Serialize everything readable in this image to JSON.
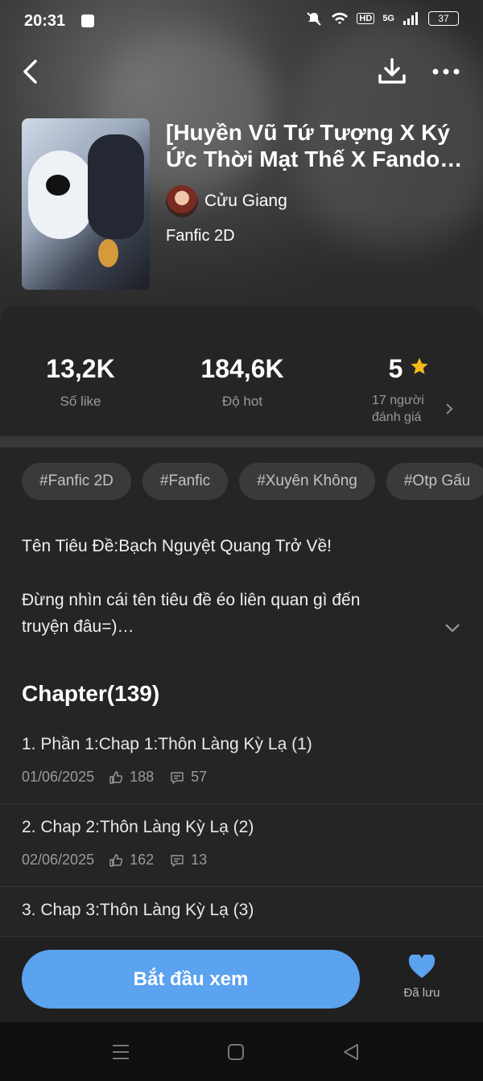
{
  "status_bar": {
    "time": "20:31",
    "hd": "HD",
    "network": "5G",
    "battery": "37"
  },
  "book": {
    "title_line1": "[Huyền Vũ Tứ Tượng X Ký",
    "title_line2": "Ức Thời Mạt Thế X Fando…",
    "author": "Cửu Giang",
    "genre": "Fanfic 2D"
  },
  "stats": {
    "likes_value": "13,2K",
    "likes_label": "Số like",
    "hot_value": "184,6K",
    "hot_label": "Độ hot",
    "rating_value": "5",
    "rating_label_1": "17 người",
    "rating_label_2": "đánh giá"
  },
  "tags": [
    "#Fanfic 2D",
    "#Fanfic",
    "#Xuyên Không",
    "#Otp Gấu"
  ],
  "description": {
    "line1": "Tên Tiêu Đề:Bạch Nguyệt Quang Trở Về!",
    "line2": "Đừng nhìn cái tên tiêu đề éo liên quan gì đến",
    "line3": "truyện đâu=)…"
  },
  "chapters": {
    "heading": "Chapter(139)",
    "items": [
      {
        "title": "1. Phần 1:Chap 1:Thôn Làng Kỳ Lạ (1)",
        "date": "01/06/2025",
        "likes": "188",
        "comments": "57"
      },
      {
        "title": "2. Chap 2:Thôn Làng Kỳ Lạ (2)",
        "date": "02/06/2025",
        "likes": "162",
        "comments": "13"
      },
      {
        "title": "3. Chap 3:Thôn Làng Kỳ Lạ (3)",
        "date": "",
        "likes": "",
        "comments": ""
      }
    ]
  },
  "actions": {
    "start_label": "Bắt đầu xem",
    "saved_label": "Đã lưu"
  },
  "colors": {
    "accent": "#5ba2ef",
    "star": "#f6b91a"
  }
}
